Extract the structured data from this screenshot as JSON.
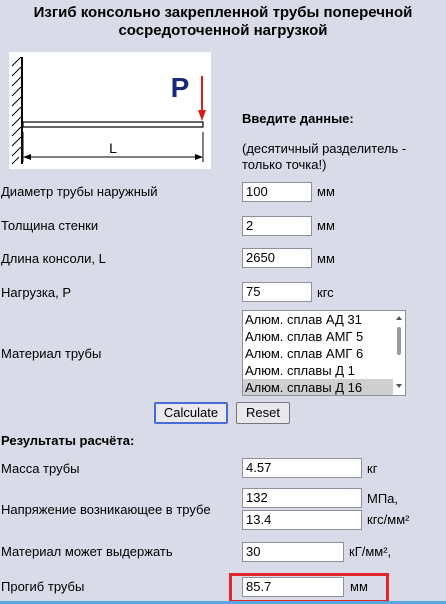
{
  "title": "Изгиб консольно закрепленной трубы поперечной сосредоточенной нагрузкой",
  "diagram": {
    "load_label": "P",
    "length_label": "L"
  },
  "input_header": "Введите данные:",
  "input_note": "(десятичный разделитель - только точка!)",
  "inputs": {
    "diameter": {
      "label": "Диаметр трубы наружный",
      "value": "100",
      "unit": "мм"
    },
    "wall": {
      "label": "Толщина стенки",
      "value": "2",
      "unit": "мм"
    },
    "length": {
      "label": "Длина консоли, L",
      "value": "2650",
      "unit": "мм"
    },
    "load": {
      "label": "Нагрузка, P",
      "value": "75",
      "unit": "кгс"
    }
  },
  "material": {
    "label": "Материал трубы",
    "options": [
      "Алюм. сплав АД 31",
      "Алюм. сплав АМГ 5",
      "Алюм. сплав АМГ 6",
      "Алюм. сплавы Д 1",
      "Алюм. сплавы Д 16"
    ],
    "selected": "Алюм. сплавы Д 16"
  },
  "buttons": {
    "calculate": "Calculate",
    "reset": "Reset"
  },
  "results_header": "Результаты расчёта:",
  "results": {
    "mass": {
      "label": "Масса трубы",
      "value": "4.57",
      "unit": "кг"
    },
    "stress": {
      "label": "Напряжение возникающее в трубе",
      "value_mpa": "132",
      "unit_mpa": "МПа,",
      "value_kgs": "13.4",
      "unit_kgs": "кгс/мм²"
    },
    "allowable": {
      "label": "Материал может выдержать",
      "value": "30",
      "unit": "кГ/мм²,"
    },
    "deflection": {
      "label": "Прогиб трубы",
      "value": "85.7",
      "unit": "мм"
    }
  },
  "colors": {
    "background": "#d9dce8",
    "highlight": "#e0282c",
    "load_arrow": "#d81c1c",
    "load_label": "#1a2a7a"
  }
}
